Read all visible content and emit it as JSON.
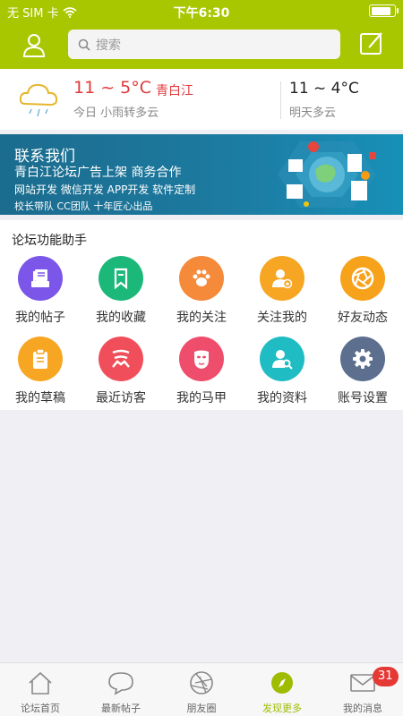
{
  "status": {
    "carrier": "无 SIM 卡",
    "time": "下午6:30",
    "battery_level": 0.85
  },
  "header": {
    "search_placeholder": "搜索",
    "profile_icon": "user-icon",
    "compose_icon": "compose-icon",
    "accent_color": "#a8c700"
  },
  "weather": {
    "today_temp": "11 ~ 5°C",
    "city": "青白江",
    "today_desc": "今日 小雨转多云",
    "tomorrow_temp": "11 ~ 4°C",
    "tomorrow_desc": "明天多云",
    "icon": "light-rain-cloud-icon"
  },
  "banner": {
    "line1": "联系我们",
    "line2": "青白江论坛广告上架 商务合作",
    "line3": "网站开发 微信开发 APP开发 软件定制",
    "line4": "校长带队 CC团队 十年匠心出品"
  },
  "features": {
    "title": "论坛功能助手",
    "items": [
      {
        "label": "我的帖子",
        "color": "#7b56e8",
        "icon": "post-icon"
      },
      {
        "label": "我的收藏",
        "color": "#1cb87a",
        "icon": "bookmark-icon"
      },
      {
        "label": "我的关注",
        "color": "#f58a3a",
        "icon": "paw-icon"
      },
      {
        "label": "关注我的",
        "color": "#f6a623",
        "icon": "follower-icon"
      },
      {
        "label": "好友动态",
        "color": "#f7a21b",
        "icon": "shutter-icon"
      },
      {
        "label": "我的草稿",
        "color": "#f6a623",
        "icon": "clipboard-icon"
      },
      {
        "label": "最近访客",
        "color": "#f04e5a",
        "icon": "visitor-icon"
      },
      {
        "label": "我的马甲",
        "color": "#ef4d6c",
        "icon": "mask-icon"
      },
      {
        "label": "我的资料",
        "color": "#1fbcc4",
        "icon": "profile-search-icon"
      },
      {
        "label": "账号设置",
        "color": "#5d6f8e",
        "icon": "gear-icon"
      }
    ]
  },
  "tabbar": {
    "items": [
      {
        "label": "论坛首页",
        "icon": "home-icon"
      },
      {
        "label": "最新帖子",
        "icon": "chat-bubble-icon"
      },
      {
        "label": "朋友圈",
        "icon": "aperture-icon"
      },
      {
        "label": "发现更多",
        "icon": "compass-icon"
      },
      {
        "label": "我的消息",
        "icon": "envelope-icon"
      }
    ],
    "active_index": 3,
    "messages_badge": "31"
  }
}
